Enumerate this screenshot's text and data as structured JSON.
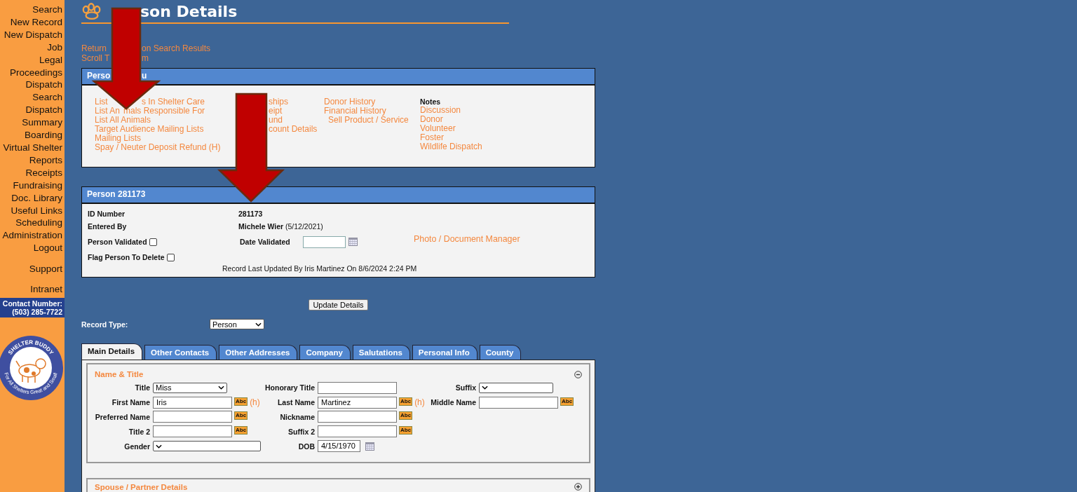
{
  "sidebar": {
    "groups": [
      [
        "Search",
        "New Record",
        "New Dispatch",
        "Job",
        "Legal",
        "Proceedings",
        "Dispatch",
        "Search",
        "Dispatch",
        "Summary",
        "Boarding",
        "Virtual Shelter",
        "Reports",
        "Receipts",
        "Fundraising",
        "Doc. Library",
        "Useful Links",
        "Scheduling",
        "Administration",
        "Logout"
      ],
      [
        "Support"
      ],
      [
        "Intranet"
      ]
    ],
    "contact": {
      "label": "Contact Number:",
      "phone": "(503) 285-7722"
    },
    "logo": {
      "top_text": "SHELTER BUDDY",
      "bottom_text": "For All Shelters Great and Small"
    }
  },
  "page": {
    "title": "son Details",
    "links": [
      {
        "before": "Return",
        "after": "on Search Results"
      },
      {
        "before": "Scroll T",
        "after": "m"
      }
    ]
  },
  "person_menu": {
    "title": {
      "before": "Perso",
      "after": "u"
    },
    "columns": [
      [
        {
          "before": "List",
          "after": "s In Shelter Care"
        },
        {
          "before": "List An",
          "after": "mals Responsible For"
        },
        {
          "text": "List All Animals"
        },
        {
          "text": "Target Audience Mailing Lists"
        },
        {
          "text": "Mailing Lists"
        },
        {
          "text": "Spay / Neuter Deposit Refund  (H)"
        }
      ],
      [
        {
          "after": "ships"
        },
        {
          "after": "eipt"
        },
        {
          "after": "und"
        },
        {
          "after": "count Details"
        }
      ],
      [
        {
          "text": "Donor History",
          "indented": false
        },
        {
          "text": "Financial History",
          "indented": false
        },
        {
          "text": "Sell Product / Service",
          "indented": true
        }
      ]
    ],
    "notes": {
      "heading": "Notes",
      "items": [
        "Discussion",
        "Donor",
        "Volunteer",
        "Foster",
        "Wildlife Dispatch"
      ]
    }
  },
  "person": {
    "title": "Person 281173",
    "id_label": "ID Number",
    "id_value": "281173",
    "entered_label": "Entered By",
    "entered_name": "Michele Wier",
    "entered_date": "(5/12/2021)",
    "validated_label": "Person Validated",
    "validated": false,
    "date_validated_label": "Date Validated",
    "flag_label": "Flag Person To Delete",
    "flag_delete": false,
    "photo_link": "Photo / Document Manager",
    "updated_note": "Record Last Updated By Iris Martinez On 8/6/2024 2:24 PM"
  },
  "update_button": "Update Details",
  "record_type": {
    "label": "Record Type:",
    "value": "Person"
  },
  "tabs": [
    {
      "label": "Main Details",
      "selected": true
    },
    {
      "label": "Other Contacts",
      "selected": false
    },
    {
      "label": "Other Addresses",
      "selected": false
    },
    {
      "label": "Company",
      "selected": false
    },
    {
      "label": "Salutations",
      "selected": false
    },
    {
      "label": "Personal Info",
      "selected": false
    },
    {
      "label": "County",
      "selected": false
    }
  ],
  "sections": [
    {
      "title": "Name & Title",
      "expanded": true,
      "columns": [
        [
          {
            "label": "Title",
            "kind": "select",
            "value": "Miss"
          },
          {
            "label": "First Name",
            "kind": "text",
            "value": "Iris",
            "spell": "Abc",
            "note": "(h)"
          },
          {
            "label": "Preferred Name",
            "kind": "text",
            "spell": "Abc"
          },
          {
            "label": "Title 2",
            "kind": "text",
            "spell": "Abc"
          },
          {
            "label": "Gender",
            "kind": "wide-select"
          }
        ],
        [
          {
            "label": "Honorary Title",
            "kind": "text"
          },
          {
            "label": "Last Name",
            "kind": "text",
            "value": "Martinez",
            "spell": "Abc",
            "note": "(h)"
          },
          {
            "label": "Nickname",
            "kind": "text",
            "spell": "Abc"
          },
          {
            "label": "Suffix 2",
            "kind": "text",
            "spell": "Abc"
          },
          {
            "label": "DOB",
            "kind": "date",
            "value": "4/15/1970"
          }
        ],
        [
          {
            "label": "Suffix",
            "kind": "select"
          },
          {
            "label": "Middle Name",
            "kind": "text",
            "spell": "Abc"
          }
        ]
      ]
    },
    {
      "title": "Spouse / Partner Details",
      "expanded": false
    }
  ]
}
